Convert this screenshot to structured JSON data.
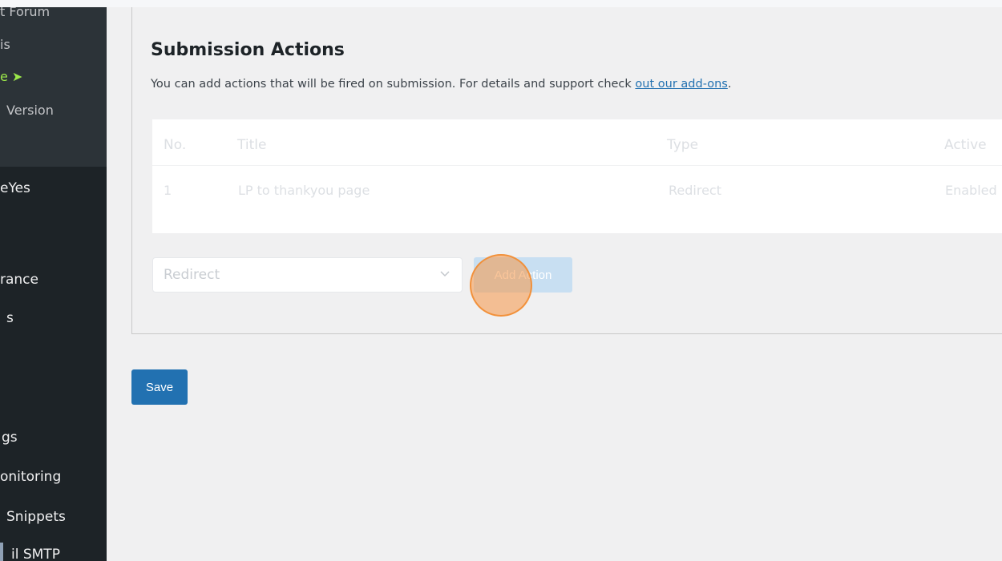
{
  "sidebar": {
    "submenu": [
      {
        "label": "t Forum"
      },
      {
        "label": "is"
      },
      {
        "label": "e ➤"
      },
      {
        "label": "Version"
      }
    ],
    "items": [
      {
        "label": "eYes"
      },
      {
        "label": "rance"
      },
      {
        "label": "s"
      },
      {
        "label": "gs"
      },
      {
        "label": "onitoring"
      },
      {
        "label": "Snippets"
      },
      {
        "label": "il SMTP"
      }
    ]
  },
  "section": {
    "title": "Submission Actions",
    "description": "You can add actions that will be fired on submission. For details and support check ",
    "link_text": "out our add-ons",
    "description_end": "."
  },
  "table": {
    "headers": [
      "No.",
      "Title",
      "Type",
      "Active"
    ],
    "rows": [
      {
        "no": "1",
        "title": "LP to thankyou page",
        "type": "Redirect",
        "active": "Enabled"
      }
    ]
  },
  "action_select": {
    "value": "Redirect"
  },
  "buttons": {
    "add_action": "Add Action",
    "save": "Save"
  },
  "colors": {
    "primary": "#2271b1",
    "sidebar": "#1d2327",
    "highlight": "#9ce84a"
  }
}
